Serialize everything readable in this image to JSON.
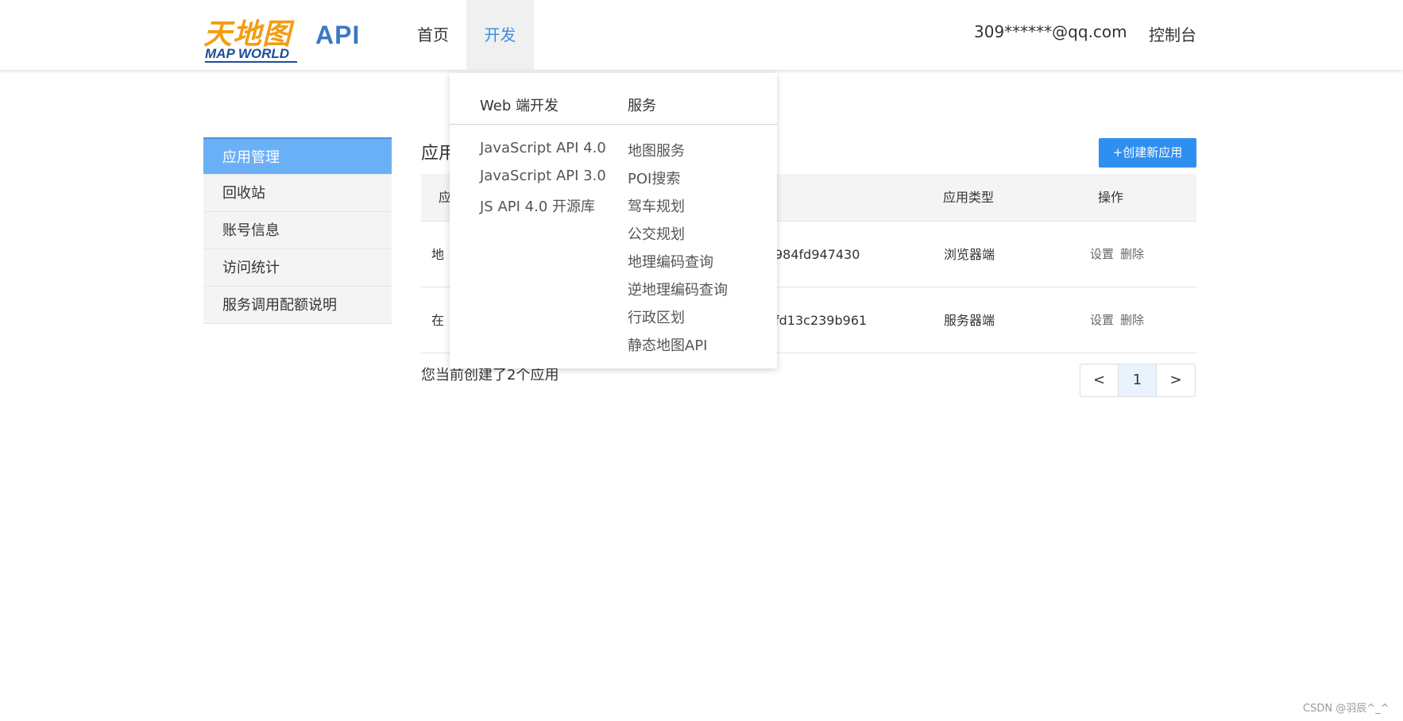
{
  "header": {
    "logo_cn": "天地图",
    "logo_en": "MAP WORLD",
    "api_label": "API",
    "nav": [
      {
        "label": "首页"
      },
      {
        "label": "开发"
      }
    ],
    "user_email": "309******@qq.com",
    "console_label": "控制台"
  },
  "dropdown": {
    "col1_title": "Web 端开发",
    "col1_items": [
      "JavaScript API 4.0",
      "JavaScript API 3.0",
      "JS API 4.0 开源库"
    ],
    "col2_title": "服务",
    "col2_items": [
      "地图服务",
      "POI搜索",
      "驾车规划",
      "公交规划",
      "地理编码查询",
      "逆地理编码查询",
      "行政区划",
      "静态地图API"
    ]
  },
  "sidebar": {
    "items": [
      {
        "label": "应用管理"
      },
      {
        "label": "回收站"
      },
      {
        "label": "账号信息"
      },
      {
        "label": "访问统计"
      },
      {
        "label": "服务调用配额说明"
      }
    ]
  },
  "main": {
    "title_partial": "应用",
    "create_button": "+创建新应用",
    "table": {
      "headers": [
        "应",
        "应用类型",
        "操作"
      ],
      "rows": [
        {
          "name_partial": "地",
          "key_partial": "984fd947430",
          "type": "浏览器端",
          "ops": [
            "设置",
            "删除"
          ]
        },
        {
          "name_partial": "在",
          "key_partial": "fd13c239b961",
          "type": "服务器端",
          "ops": [
            "设置",
            "删除"
          ]
        }
      ]
    },
    "summary": "您当前创建了2个应用",
    "pager": {
      "prev": "<",
      "current": "1",
      "next": ">"
    }
  },
  "watermark": "CSDN @羽辰^_^"
}
